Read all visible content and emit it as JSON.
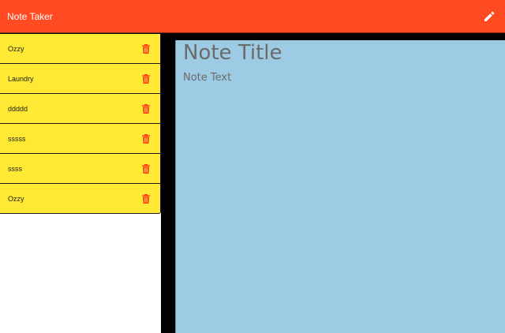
{
  "navbar": {
    "brand": "Note Taker",
    "new_note_icon": "pencil-icon"
  },
  "sidebar": {
    "items": [
      {
        "label": "Ozzy"
      },
      {
        "label": "Laundry"
      },
      {
        "label": "ddddd"
      },
      {
        "label": "sssss"
      },
      {
        "label": "ssss"
      },
      {
        "label": "Ozzy"
      }
    ],
    "delete_icon": "trash-icon"
  },
  "editor": {
    "title_placeholder": "Note Title",
    "text_placeholder": "Note Text",
    "title_value": "",
    "text_value": ""
  },
  "colors": {
    "navbar": "#ff4a22",
    "note_item": "#ffe935",
    "trash": "#ff3b1d",
    "editor": "#9ccbe3",
    "background": "#000000"
  }
}
